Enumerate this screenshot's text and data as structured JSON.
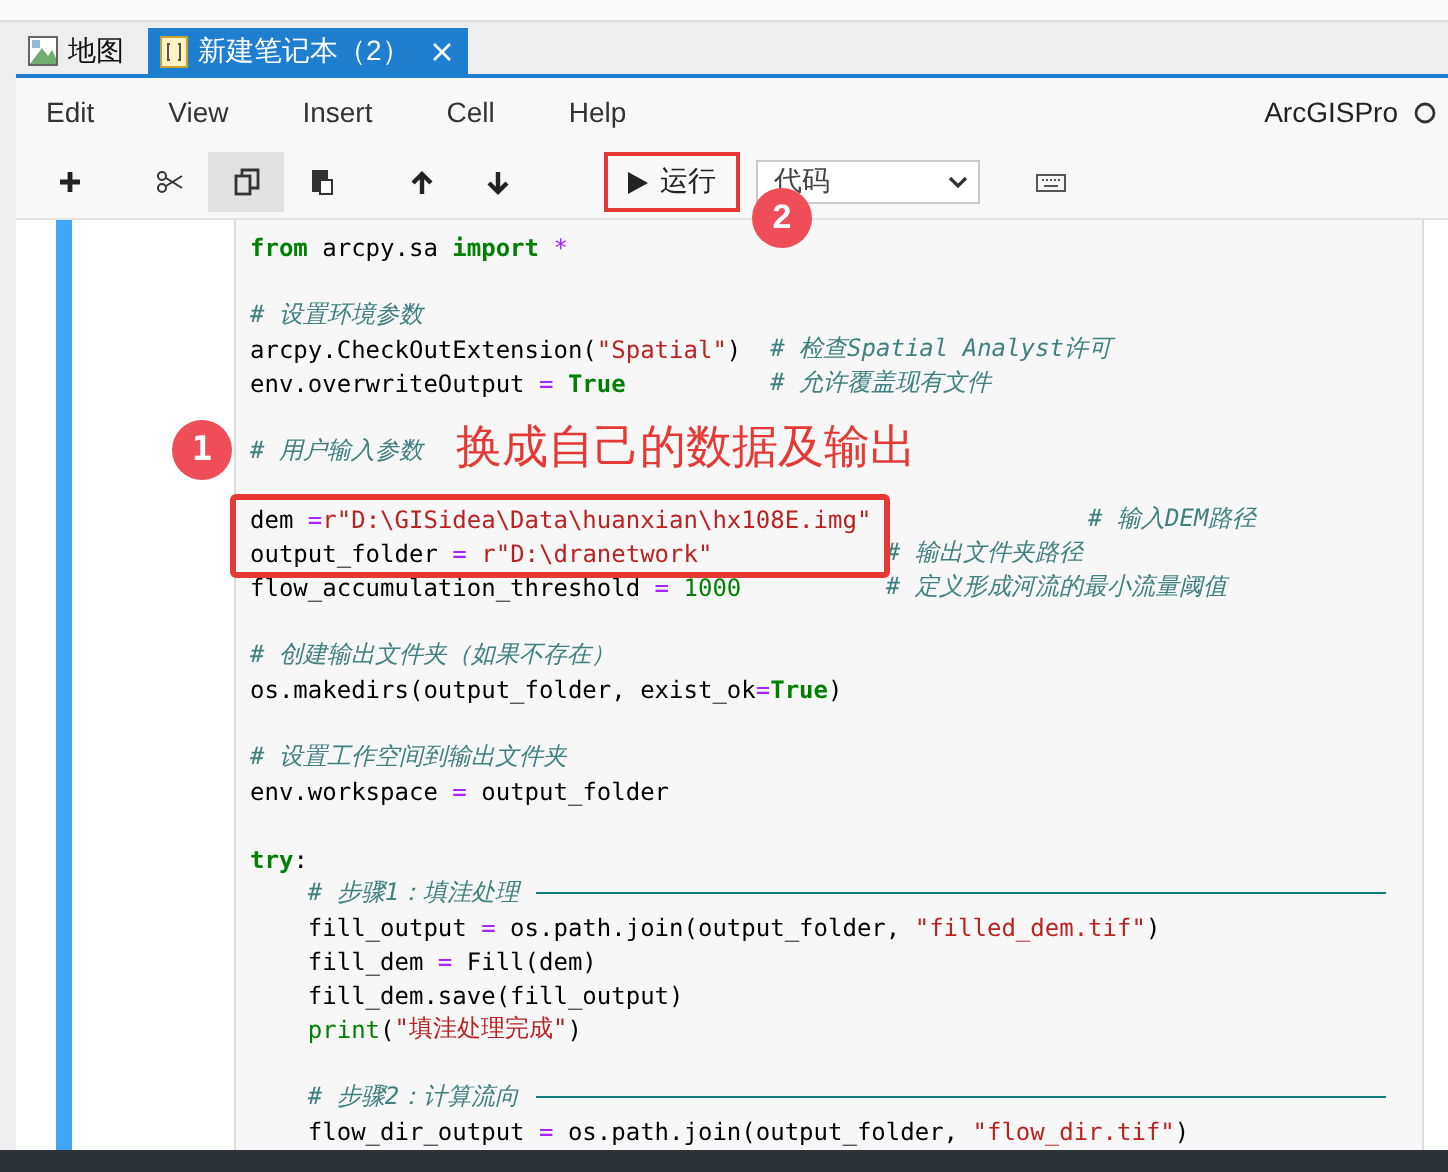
{
  "tabs": [
    {
      "label": "地图",
      "selected": false
    },
    {
      "label": "新建笔记本（2）",
      "selected": true
    }
  ],
  "menu": [
    "Edit",
    "View",
    "Insert",
    "Cell",
    "Help"
  ],
  "kernel": {
    "name": "ArcGISPro",
    "busy": false
  },
  "toolbar": [
    {
      "kind": "add",
      "pressed": false
    },
    {
      "kind": "cut",
      "pressed": false
    },
    {
      "kind": "copy",
      "pressed": true
    },
    {
      "kind": "paste",
      "pressed": false
    },
    {
      "kind": "up",
      "pressed": false
    },
    {
      "kind": "down",
      "pressed": false
    },
    {
      "kind": "run",
      "label": "运行",
      "highlighted": true,
      "marker": "2"
    },
    {
      "kind": "select",
      "value": "代码"
    },
    {
      "kind": "keyboard",
      "pressed": false
    }
  ],
  "cell": {
    "selected": true,
    "lines": [
      {
        "kind": "code",
        "tokens": [
          {
            "kind": "keyword",
            "text": "from"
          },
          {
            "kind": "plain",
            "text": " arcpy.sa "
          },
          {
            "kind": "keyword",
            "text": "import"
          },
          {
            "kind": "operator",
            "text": " *"
          }
        ]
      },
      {
        "kind": "blank"
      },
      {
        "kind": "code",
        "tokens": [
          {
            "kind": "comment",
            "text": "# 设置环境参数"
          }
        ]
      },
      {
        "kind": "code",
        "tokens": [
          {
            "kind": "plain",
            "text": "arcpy.CheckOutExtension("
          },
          {
            "kind": "string",
            "text": "\"Spatial\""
          },
          {
            "kind": "plain",
            "text": ")  "
          },
          {
            "kind": "comment",
            "text": "# 检查Spatial Analyst许可"
          }
        ]
      },
      {
        "kind": "code",
        "tokens": [
          {
            "kind": "plain",
            "text": "env.overwriteOutput "
          },
          {
            "kind": "operator",
            "text": "="
          },
          {
            "kind": "keyword",
            "text": " True          "
          },
          {
            "kind": "comment",
            "text": "# 允许覆盖现有文件"
          }
        ]
      },
      {
        "kind": "blank"
      },
      {
        "kind": "code",
        "note": "换成自己的数据及输出",
        "marker": "1",
        "tokens": [
          {
            "kind": "comment",
            "text": "# 用户输入参数"
          }
        ]
      },
      {
        "kind": "blank"
      },
      {
        "kind": "code",
        "boxed": true,
        "tokens": [
          {
            "kind": "plain",
            "text": "dem "
          },
          {
            "kind": "operator",
            "text": "="
          },
          {
            "kind": "string",
            "text": "r\"D:\\GISidea\\Data\\huanxian\\hx108E.img\"               "
          },
          {
            "kind": "comment",
            "text": "# 输入DEM路径"
          }
        ]
      },
      {
        "kind": "code",
        "boxed": true,
        "tokens": [
          {
            "kind": "plain",
            "text": "output_folder "
          },
          {
            "kind": "operator",
            "text": "="
          },
          {
            "kind": "string",
            "text": " r\"D:\\dranetwork\"            "
          },
          {
            "kind": "comment",
            "text": "# 输出文件夹路径"
          }
        ]
      },
      {
        "kind": "code",
        "tokens": [
          {
            "kind": "plain",
            "text": "flow_accumulation_threshold "
          },
          {
            "kind": "operator",
            "text": "="
          },
          {
            "kind": "number",
            "text": " 1000          "
          },
          {
            "kind": "comment",
            "text": "# 定义形成河流的最小流量阈值"
          }
        ]
      },
      {
        "kind": "blank"
      },
      {
        "kind": "code",
        "tokens": [
          {
            "kind": "comment",
            "text": "# 创建输出文件夹（如果不存在）"
          }
        ]
      },
      {
        "kind": "code",
        "tokens": [
          {
            "kind": "plain",
            "text": "os.makedirs(output_folder, exist_ok"
          },
          {
            "kind": "operator",
            "text": "="
          },
          {
            "kind": "keyword",
            "text": "True"
          },
          {
            "kind": "plain",
            "text": ")"
          }
        ]
      },
      {
        "kind": "blank"
      },
      {
        "kind": "code",
        "tokens": [
          {
            "kind": "comment",
            "text": "# 设置工作空间到输出文件夹"
          }
        ]
      },
      {
        "kind": "code",
        "tokens": [
          {
            "kind": "plain",
            "text": "env.workspace "
          },
          {
            "kind": "operator",
            "text": "="
          },
          {
            "kind": "plain",
            "text": " output_folder"
          }
        ]
      },
      {
        "kind": "blank"
      },
      {
        "kind": "code",
        "tokens": [
          {
            "kind": "keyword",
            "text": "try"
          },
          {
            "kind": "plain",
            "text": ":"
          }
        ]
      },
      {
        "kind": "section",
        "tokens": [
          {
            "kind": "comment",
            "text": "    # 步骤1：填洼处理"
          }
        ]
      },
      {
        "kind": "code",
        "tokens": [
          {
            "kind": "plain",
            "text": "    fill_output "
          },
          {
            "kind": "operator",
            "text": "="
          },
          {
            "kind": "plain",
            "text": " os.path.join(output_folder, "
          },
          {
            "kind": "string",
            "text": "\"filled_dem.tif\""
          },
          {
            "kind": "plain",
            "text": ")"
          }
        ]
      },
      {
        "kind": "code",
        "tokens": [
          {
            "kind": "plain",
            "text": "    fill_dem "
          },
          {
            "kind": "operator",
            "text": "="
          },
          {
            "kind": "plain",
            "text": " Fill(dem)"
          }
        ]
      },
      {
        "kind": "code",
        "tokens": [
          {
            "kind": "plain",
            "text": "    fill_dem.save(fill_output)"
          }
        ]
      },
      {
        "kind": "code",
        "tokens": [
          {
            "kind": "builtin",
            "text": "    print"
          },
          {
            "kind": "plain",
            "text": "("
          },
          {
            "kind": "string",
            "text": "\"填洼处理完成\""
          },
          {
            "kind": "plain",
            "text": ")"
          }
        ]
      },
      {
        "kind": "blank"
      },
      {
        "kind": "section",
        "tokens": [
          {
            "kind": "comment",
            "text": "    # 步骤2：计算流向"
          }
        ]
      },
      {
        "kind": "code",
        "tokens": [
          {
            "kind": "plain",
            "text": "    flow_dir_output "
          },
          {
            "kind": "operator",
            "text": "="
          },
          {
            "kind": "plain",
            "text": " os.path.join(output_folder, "
          },
          {
            "kind": "string",
            "text": "\"flow_dir.tif\""
          },
          {
            "kind": "plain",
            "text": ")"
          }
        ]
      }
    ]
  }
}
